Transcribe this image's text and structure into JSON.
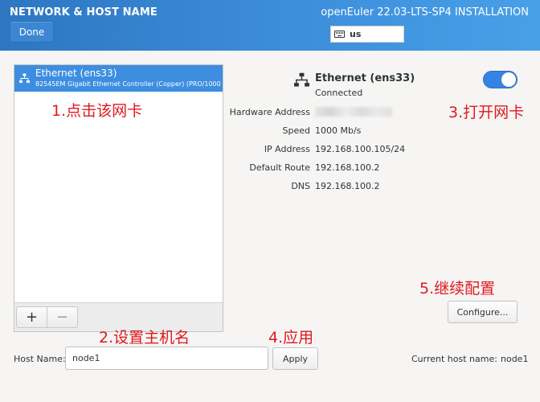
{
  "header": {
    "title": "NETWORK & HOST NAME",
    "done_label": "Done",
    "install_title": "openEuler 22.03-LTS-SP4 INSTALLATION",
    "keyboard_layout": "us"
  },
  "device_list": {
    "items": [
      {
        "name": "Ethernet (ens33)",
        "description": "82545EM Gigabit Ethernet Controller (Copper) (PRO/1000",
        "selected": true
      }
    ],
    "add_label": "+",
    "remove_label": "−"
  },
  "details": {
    "name": "Ethernet (ens33)",
    "status": "Connected",
    "enabled": true,
    "rows": [
      {
        "label": "Hardware Address",
        "value": ""
      },
      {
        "label": "Speed",
        "value": "1000 Mb/s"
      },
      {
        "label": "IP Address",
        "value": "192.168.100.105/24"
      },
      {
        "label": "Default Route",
        "value": "192.168.100.2"
      },
      {
        "label": "DNS",
        "value": "192.168.100.2"
      }
    ],
    "configure_label": "Configure..."
  },
  "hostname": {
    "label": "Host Name:",
    "value": "node1",
    "apply_label": "Apply",
    "current_label": "Current host name:",
    "current_value": "node1"
  },
  "annotations": {
    "step1": "1.点击该网卡",
    "step2": "2.设置主机名",
    "step3": "3.打开网卡",
    "step4": "4.应用",
    "step5": "5.继续配置"
  },
  "colors": {
    "header_start": "#2d76c1",
    "header_end": "#48a0e8",
    "selection": "#3d8ee0",
    "toggle_on": "#3584e4",
    "annotation": "#e0191f"
  },
  "icons": {
    "network": "network-wired-icon",
    "keyboard": "keyboard-icon"
  }
}
